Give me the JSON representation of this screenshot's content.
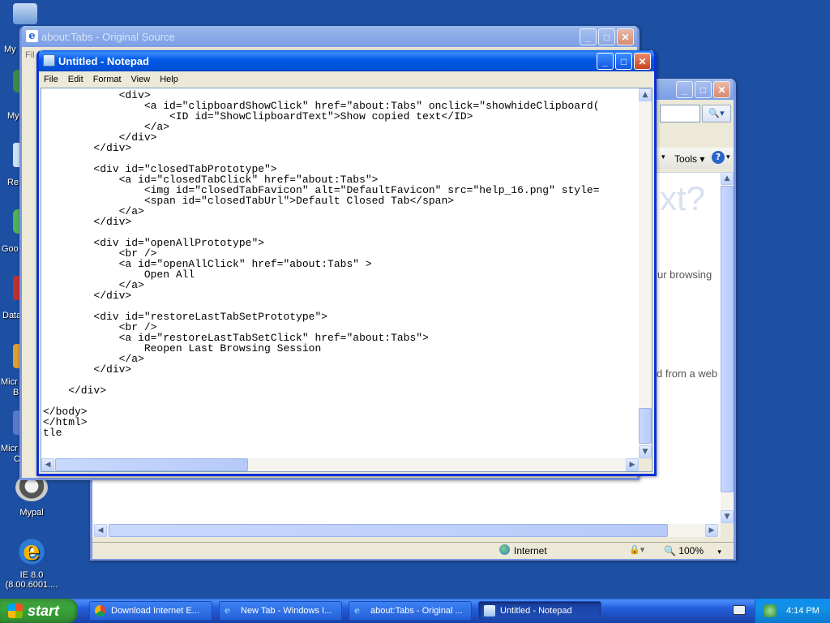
{
  "desktop": {
    "icons": [
      {
        "label": "Mypal"
      },
      {
        "label": "IE 8.0 (8.00.6001...."
      }
    ],
    "clipped_labels": [
      "My",
      "My",
      "Re",
      "Goo",
      "Data",
      "Micr",
      "B",
      "Micr",
      "C++"
    ]
  },
  "ie_source_window": {
    "title": "about:Tabs - Original Source",
    "menu_fragment": "Fil"
  },
  "ie_browser_window": {
    "toolbar_tools": "Tools",
    "page_heading_fragment": "xt?",
    "page_text_1": "ur browsing",
    "page_text_2": "d from a web",
    "status_zone": "Internet",
    "zoom": "100%"
  },
  "notepad": {
    "title": "Untitled - Notepad",
    "menu": [
      "File",
      "Edit",
      "Format",
      "View",
      "Help"
    ],
    "content": "            <div>\n                <a id=\"clipboardShowClick\" href=\"about:Tabs\" onclick=\"showhideClipboard(\n                    <ID id=\"ShowClipboardText\">Show copied text</ID>\n                </a>\n            </div>\n        </div>\n\n        <div id=\"closedTabPrototype\">\n            <a id=\"closedTabClick\" href=\"about:Tabs\">\n                <img id=\"closedTabFavicon\" alt=\"DefaultFavicon\" src=\"help_16.png\" style=\n                <span id=\"closedTabUrl\">Default Closed Tab</span>\n            </a>\n        </div>\n\n        <div id=\"openAllPrototype\">\n            <br />\n            <a id=\"openAllClick\" href=\"about:Tabs\" >\n                Open All\n            </a>\n        </div>\n\n        <div id=\"restoreLastTabSetPrototype\">\n            <br />\n            <a id=\"restoreLastTabSetClick\" href=\"about:Tabs\">\n                Reopen Last Browsing Session\n            </a>\n        </div>\n\n    </div>\n\n</body>\n</html>\ntle"
  },
  "taskbar": {
    "start_label": "start",
    "tasks": [
      {
        "label": "Download Internet E..."
      },
      {
        "label": "New Tab - Windows I..."
      },
      {
        "label": "about:Tabs - Original ..."
      },
      {
        "label": "Untitled - Notepad"
      }
    ],
    "clock": "4:14 PM"
  },
  "colors": {
    "desktop": "#1d4fa3",
    "title_active": "#0058e6",
    "start_green": "#3aa43a"
  }
}
